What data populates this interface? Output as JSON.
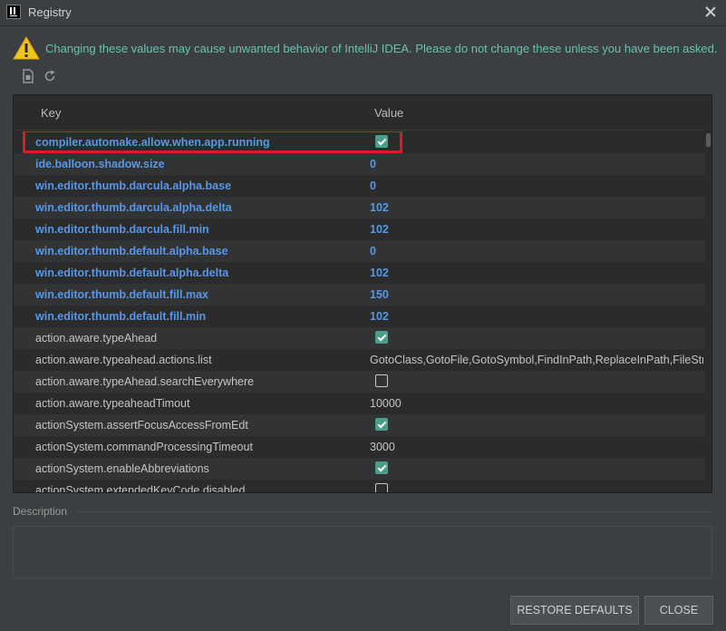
{
  "window": {
    "title": "Registry"
  },
  "warning": {
    "text": "Changing these values may cause unwanted behavior of IntelliJ IDEA. Please do not change these unless you have been asked."
  },
  "toolbar": {
    "icons": [
      "document-icon",
      "refresh-icon"
    ]
  },
  "table": {
    "headers": {
      "key": "Key",
      "value": "Value"
    },
    "rows": [
      {
        "key": "compiler.automake.allow.when.app.running",
        "type": "bool",
        "value": true,
        "modified": true,
        "highlighted": true
      },
      {
        "key": "ide.balloon.shadow.size",
        "type": "text",
        "value": "0",
        "modified": true
      },
      {
        "key": "win.editor.thumb.darcula.alpha.base",
        "type": "text",
        "value": "0",
        "modified": true
      },
      {
        "key": "win.editor.thumb.darcula.alpha.delta",
        "type": "text",
        "value": "102",
        "modified": true
      },
      {
        "key": "win.editor.thumb.darcula.fill.min",
        "type": "text",
        "value": "102",
        "modified": true
      },
      {
        "key": "win.editor.thumb.default.alpha.base",
        "type": "text",
        "value": "0",
        "modified": true
      },
      {
        "key": "win.editor.thumb.default.alpha.delta",
        "type": "text",
        "value": "102",
        "modified": true
      },
      {
        "key": "win.editor.thumb.default.fill.max",
        "type": "text",
        "value": "150",
        "modified": true
      },
      {
        "key": "win.editor.thumb.default.fill.min",
        "type": "text",
        "value": "102",
        "modified": true
      },
      {
        "key": "action.aware.typeAhead",
        "type": "bool",
        "value": true,
        "modified": false
      },
      {
        "key": "action.aware.typeahead.actions.list",
        "type": "text",
        "value": "GotoClass,GotoFile,GotoSymbol,FindInPath,ReplaceInPath,FileStruc...",
        "modified": false
      },
      {
        "key": "action.aware.typeAhead.searchEverywhere",
        "type": "bool",
        "value": false,
        "modified": false
      },
      {
        "key": "action.aware.typeaheadTimout",
        "type": "text",
        "value": "10000",
        "modified": false
      },
      {
        "key": "actionSystem.assertFocusAccessFromEdt",
        "type": "bool",
        "value": true,
        "modified": false
      },
      {
        "key": "actionSystem.commandProcessingTimeout",
        "type": "text",
        "value": "3000",
        "modified": false
      },
      {
        "key": "actionSystem.enableAbbreviations",
        "type": "bool",
        "value": true,
        "modified": false
      },
      {
        "key": "actionSystem.extendedKeyCode.disabled",
        "type": "bool",
        "value": false,
        "modified": false
      }
    ]
  },
  "description": {
    "label": "Description",
    "text": ""
  },
  "buttons": {
    "restore": "RESTORE DEFAULTS",
    "close": "CLOSE"
  },
  "colors": {
    "modified_key": "#5797e6",
    "warning_text": "#66c2b1",
    "checkbox_on": "#4b9e8c",
    "highlight_box": "#e01a24"
  }
}
